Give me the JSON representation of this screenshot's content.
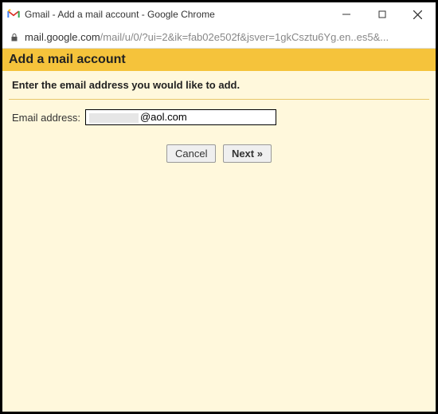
{
  "window": {
    "title": "Gmail - Add a mail account - Google Chrome"
  },
  "addressbar": {
    "host": "mail.google.com",
    "path": "/mail/u/0/?ui=2&ik=fab02e502f&jsver=1gkCsztu6Yg.en..es5&..."
  },
  "page": {
    "heading": "Add a mail account",
    "instruction": "Enter the email address you would like to add.",
    "email_label": "Email address:",
    "email_value_suffix": "@aol.com",
    "buttons": {
      "cancel": "Cancel",
      "next": "Next »"
    }
  }
}
